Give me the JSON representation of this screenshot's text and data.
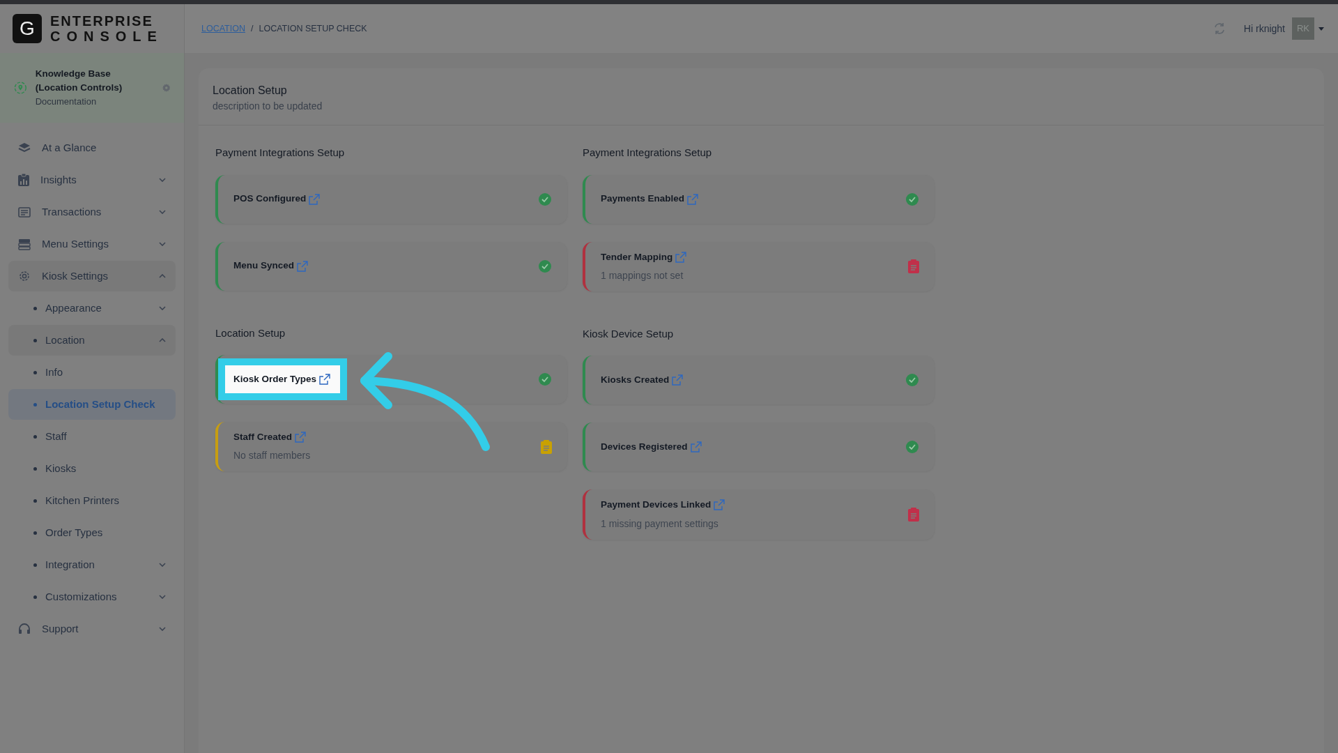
{
  "brand": {
    "mark": "G",
    "line_1": "ENTERPRISE",
    "line_2": "CONSOLE"
  },
  "breadcrumb": {
    "items": [
      {
        "label": "LOCATION",
        "link": true
      },
      {
        "label": "LOCATION SETUP CHECK",
        "link": false
      }
    ],
    "separator": "/"
  },
  "user": {
    "greeting": "Hi rknight",
    "initials": "RK"
  },
  "workspace": {
    "title": "Knowledge Base (Location Controls)",
    "subtitle": "Documentation"
  },
  "sidebar": {
    "items": [
      {
        "label": "At a Glance",
        "selected": false
      },
      {
        "label": "Insights",
        "expanded": false,
        "selected": false
      },
      {
        "label": "Transactions",
        "expanded": false,
        "selected": false
      },
      {
        "label": "Menu Settings",
        "expanded": false,
        "selected": false
      },
      {
        "label": "Kiosk Settings",
        "expanded": true,
        "selected": false,
        "children": [
          {
            "label": "Appearance",
            "expanded": false,
            "selected": false
          },
          {
            "label": "Location",
            "expanded": true,
            "selected": false
          },
          {
            "label": "Info",
            "selected": false
          },
          {
            "label": "Location Setup Check",
            "selected": true
          },
          {
            "label": "Staff",
            "selected": false
          },
          {
            "label": "Kiosks",
            "selected": false
          },
          {
            "label": "Kitchen Printers",
            "selected": false
          },
          {
            "label": "Order Types",
            "selected": false
          },
          {
            "label": "Integration",
            "expanded": false,
            "selected": false
          },
          {
            "label": "Customizations",
            "expanded": false,
            "selected": false
          }
        ]
      },
      {
        "label": "Support",
        "expanded": false,
        "selected": false
      }
    ]
  },
  "page": {
    "title": "Location Setup",
    "description": "description to be updated"
  },
  "columns": [
    {
      "sections": [
        {
          "title": "Payment Integrations Setup",
          "checks": [
            {
              "label": "POS Configured",
              "kind": "done",
              "highlighted": false
            },
            {
              "label": "Menu Synced",
              "kind": "done",
              "highlighted": false
            }
          ]
        },
        {
          "title": "Location Setup",
          "checks": [
            {
              "label": "Kiosk Order Types",
              "kind": "done",
              "highlighted": true
            },
            {
              "label": "Staff Created",
              "kind": "warning",
              "detail": "No staff members",
              "highlighted": false
            }
          ]
        }
      ]
    },
    {
      "sections": [
        {
          "title": "Payment Integrations Setup",
          "checks": [
            {
              "label": "Payments Enabled",
              "kind": "done",
              "highlighted": false
            },
            {
              "label": "Tender Mapping",
              "kind": "error",
              "detail": "1 mappings not set",
              "highlighted": false
            }
          ]
        },
        {
          "title": "Kiosk Device Setup",
          "checks": [
            {
              "label": "Kiosks Created",
              "kind": "done",
              "highlighted": false
            },
            {
              "label": "Devices Registered",
              "kind": "done",
              "highlighted": false
            },
            {
              "label": "Payment Devices Linked",
              "kind": "error",
              "detail": "1 missing payment settings",
              "highlighted": false
            }
          ]
        }
      ]
    }
  ]
}
